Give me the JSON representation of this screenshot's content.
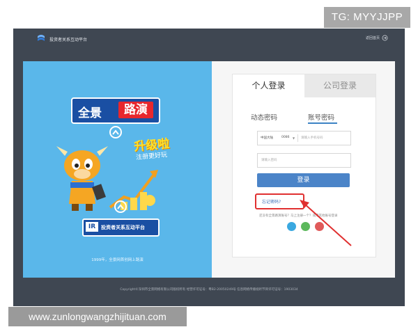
{
  "watermarks": {
    "tg": "TG: MYYJJPP",
    "site": "www.zunlongwangzhijituan.com"
  },
  "topbar": {
    "title": "投资者关系互动平台",
    "home_link": "返回首页"
  },
  "banner": {
    "brand_left": "全景",
    "brand_right": "路演",
    "upgrade_title": "升级啦",
    "upgrade_sub": "注册更好玩",
    "platform_badge": "IR",
    "platform_name": "投资者关系互动平台",
    "footer": "1999年，全景网首创网上路演"
  },
  "login": {
    "tabs": [
      {
        "label": "个人登录",
        "active": true
      },
      {
        "label": "公司登录",
        "active": false
      }
    ],
    "subtabs": [
      {
        "label": "动态密码",
        "active": false
      },
      {
        "label": "账号密码",
        "active": true
      }
    ],
    "region": "中国大陆",
    "country_code": "0086",
    "phone_placeholder": "请输入手机号码",
    "password_placeholder": "请输入密码",
    "submit_label": "登录",
    "forgot_label": "忘记密码?",
    "register_prompt": "还没有全景路演账号？马上注册一个？或用其他账号登录",
    "social": [
      "qq-icon",
      "wechat-icon",
      "weibo-icon"
    ]
  },
  "footer": {
    "copyright": "Copyright©深圳市全景网络有限公司版权所有  经营许可证号：粤B2-20050249号  信息网络传播视听节目许可证号：1903034"
  },
  "colors": {
    "accent": "#4b84c8",
    "highlight": "#e03030",
    "banner_bg": "#5ab7ea"
  }
}
